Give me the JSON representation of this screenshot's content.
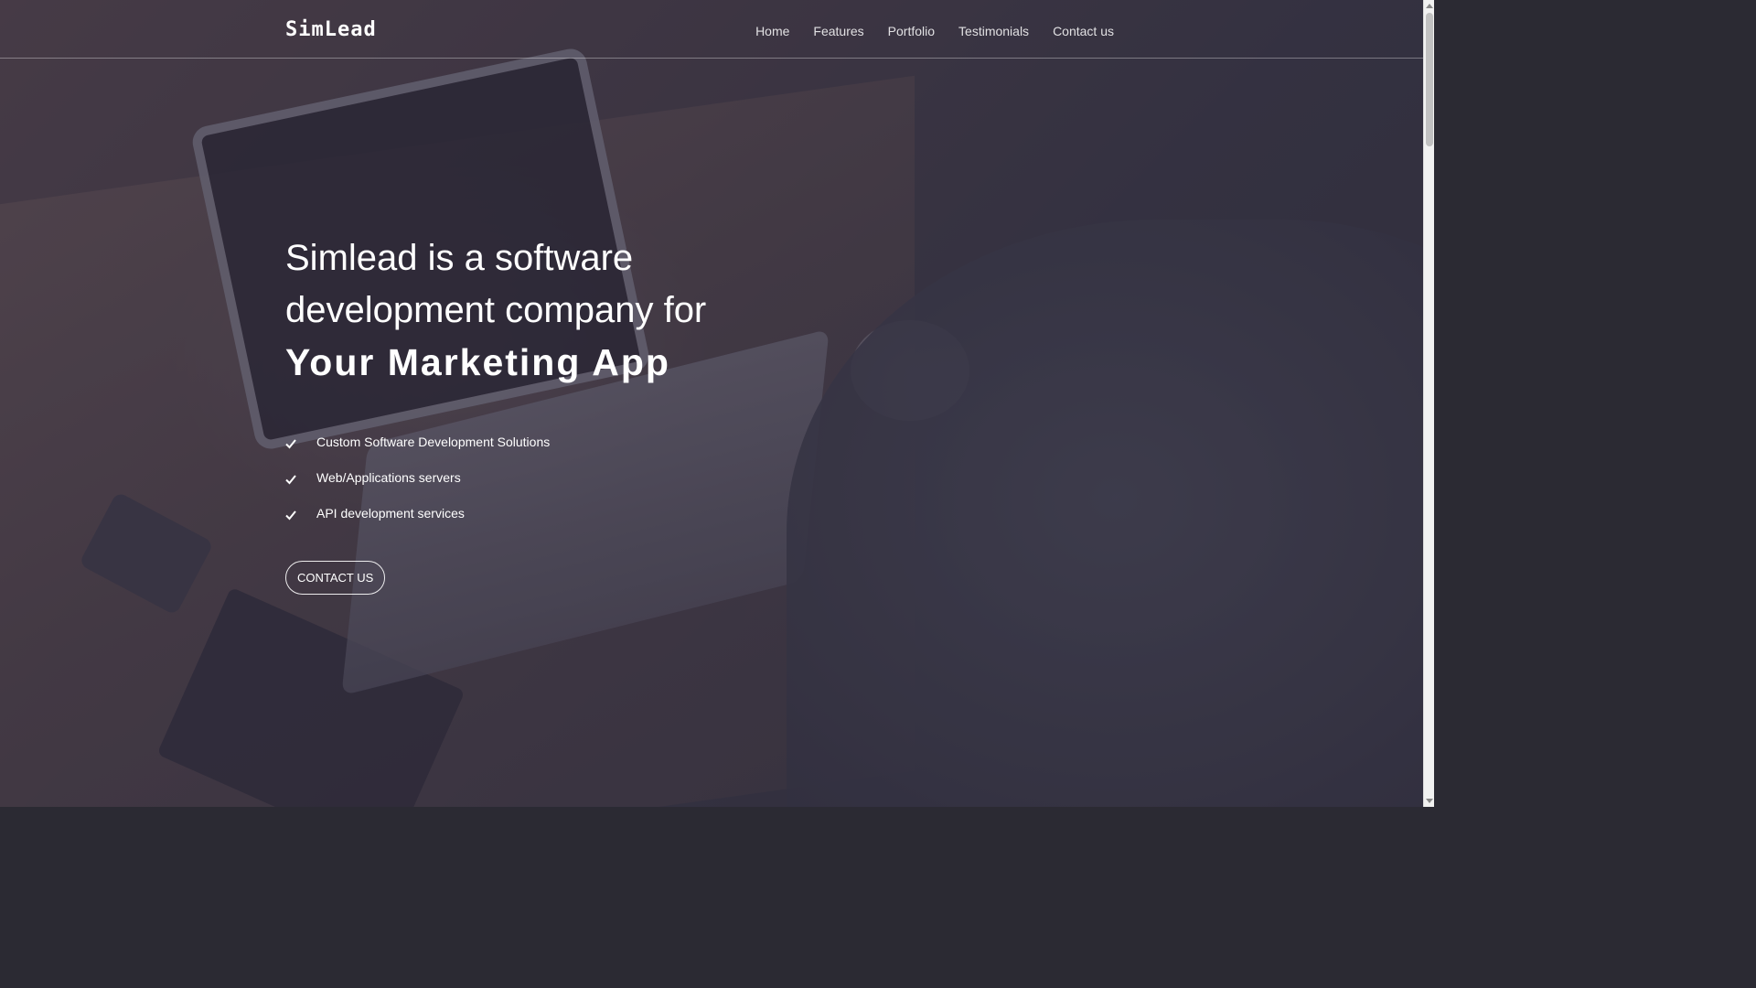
{
  "brand": {
    "logo_text": "SimLead"
  },
  "nav": {
    "items": [
      "Home",
      "Features",
      "Portfolio",
      "Testimonials",
      "Contact us"
    ]
  },
  "hero": {
    "headline_line1": "Simlead is a software",
    "headline_line2": "development company for",
    "headline_bold": "Your Marketing App",
    "features": [
      "Custom Software Development Solutions",
      "Web/Applications servers",
      "API development services"
    ],
    "cta_label": "CONTACT US"
  },
  "icons": {
    "feature_bullet": "check-icon"
  }
}
